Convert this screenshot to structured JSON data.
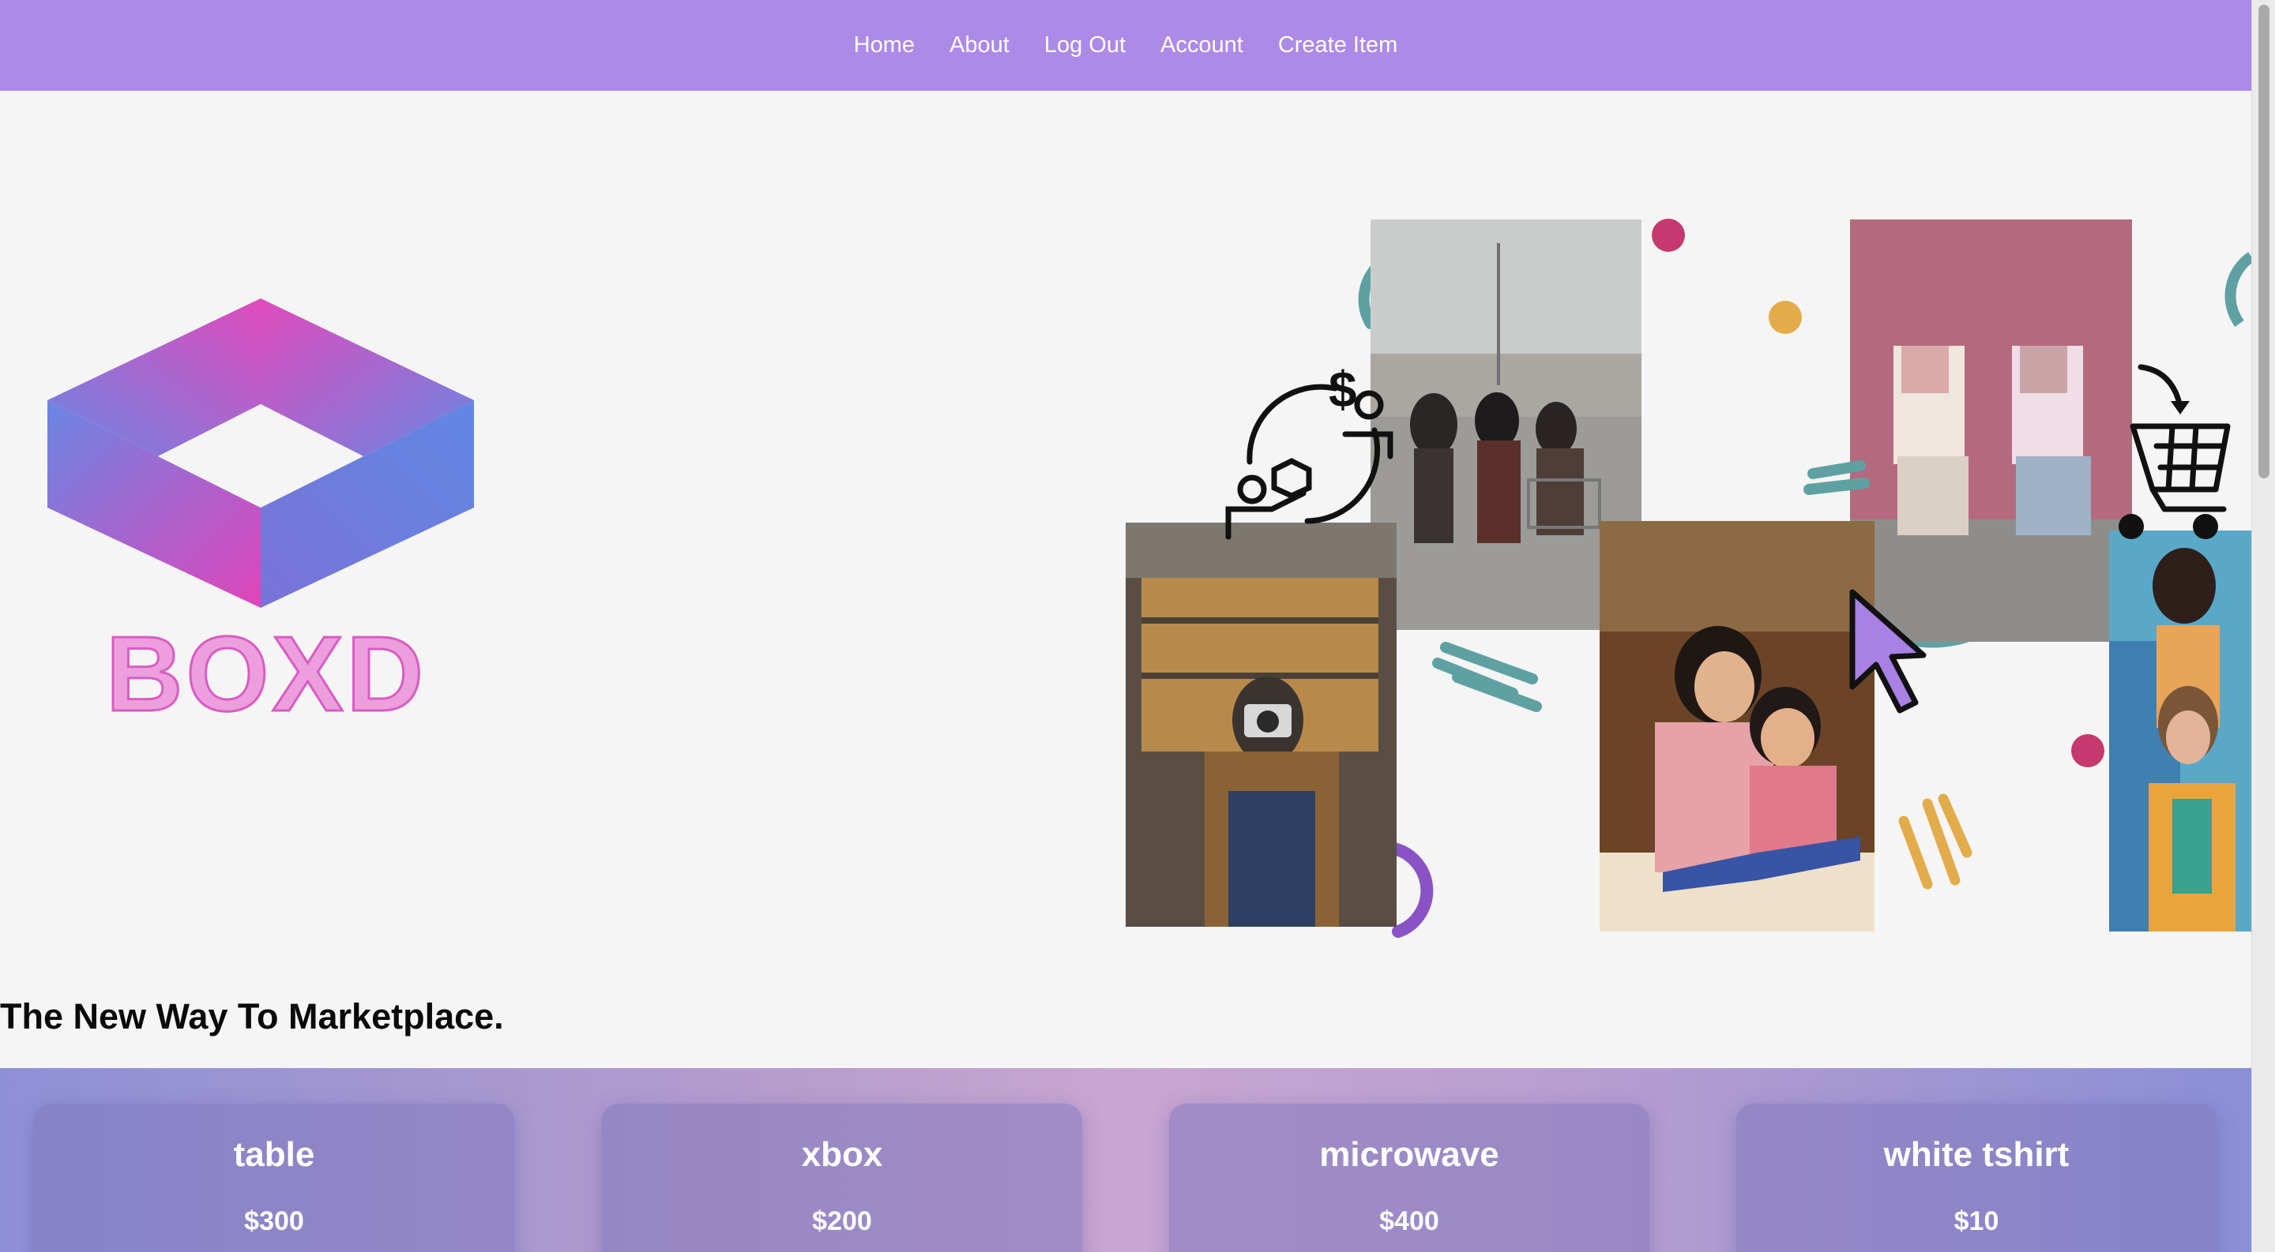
{
  "nav": {
    "items": [
      {
        "label": "Home"
      },
      {
        "label": "About"
      },
      {
        "label": "Log Out"
      },
      {
        "label": "Account"
      },
      {
        "label": "Create Item"
      }
    ],
    "background": "#ad89e8"
  },
  "hero": {
    "logo_text": "BOXD",
    "tagline": "The New Way To Marketplace."
  },
  "listings": [
    {
      "name": "table",
      "price": "$300"
    },
    {
      "name": "xbox",
      "price": "$200"
    },
    {
      "name": "microwave",
      "price": "$400"
    },
    {
      "name": "white tshirt",
      "price": "$10"
    }
  ],
  "colors": {
    "accent_pink": "#e055c4",
    "accent_blue": "#6e86e0",
    "teal": "#5fa1a3",
    "mustard": "#e3ac4b",
    "magenta_dot": "#c6396e"
  }
}
